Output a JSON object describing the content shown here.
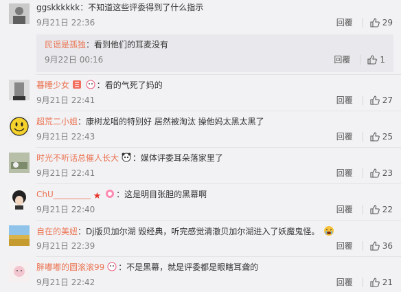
{
  "comments": [
    {
      "user": "ggskkkkkk",
      "sep": "：",
      "text": "不知道这些评委得到了什么指示",
      "time": "9月21日 22:36",
      "reply": "回覆",
      "likes": "29",
      "sub": {
        "user": "民谣是孤独",
        "sep": "：",
        "text": "看到他们的耳麦没有",
        "time": "9月22日 00:16",
        "reply": "回覆",
        "likes": "1"
      }
    },
    {
      "user": "暮睡少女",
      "sep": "：",
      "text": "看的气死了妈的",
      "time": "9月21日 22:41",
      "reply": "回覆",
      "likes": "27"
    },
    {
      "user": "超荒二小姐",
      "sep": "：",
      "text": "康树龙唱的特别好 居然被淘汰 操他妈太黑太黑了",
      "time": "9月21日 22:43",
      "reply": "回覆",
      "likes": "25"
    },
    {
      "user": "时光不听话总催人长大",
      "sep": "：",
      "text": "媒体评委耳朵落家里了",
      "time": "9月21日 22:41",
      "reply": "回覆",
      "likes": "23"
    },
    {
      "user": "ChU_________",
      "sep": "：",
      "text": "这是明目张胆的黑幕啊",
      "time": "9月21日 22:40",
      "reply": "回覆",
      "likes": "22"
    },
    {
      "user": "自在的美妞",
      "sep": "：",
      "text": "Dj版贝加尔湖 毁经典，听完感觉清澈贝加尔湖进入了妖魔鬼怪。",
      "time": "9月21日 22:39",
      "reply": "回覆",
      "likes": "36"
    },
    {
      "user": "胖嘟嘟的圆滚滚99",
      "sep": "：",
      "text": "不是黑幕，就是评委都是眼瞎耳聋的",
      "time": "9月21日 22:42",
      "reply": "回覆",
      "likes": "21"
    }
  ],
  "icons": {
    "like": "thumbs-up-icon"
  },
  "colors": {
    "username": "#eb7350",
    "text": "#333333",
    "time": "#808080",
    "background": "#f2f2f5"
  }
}
